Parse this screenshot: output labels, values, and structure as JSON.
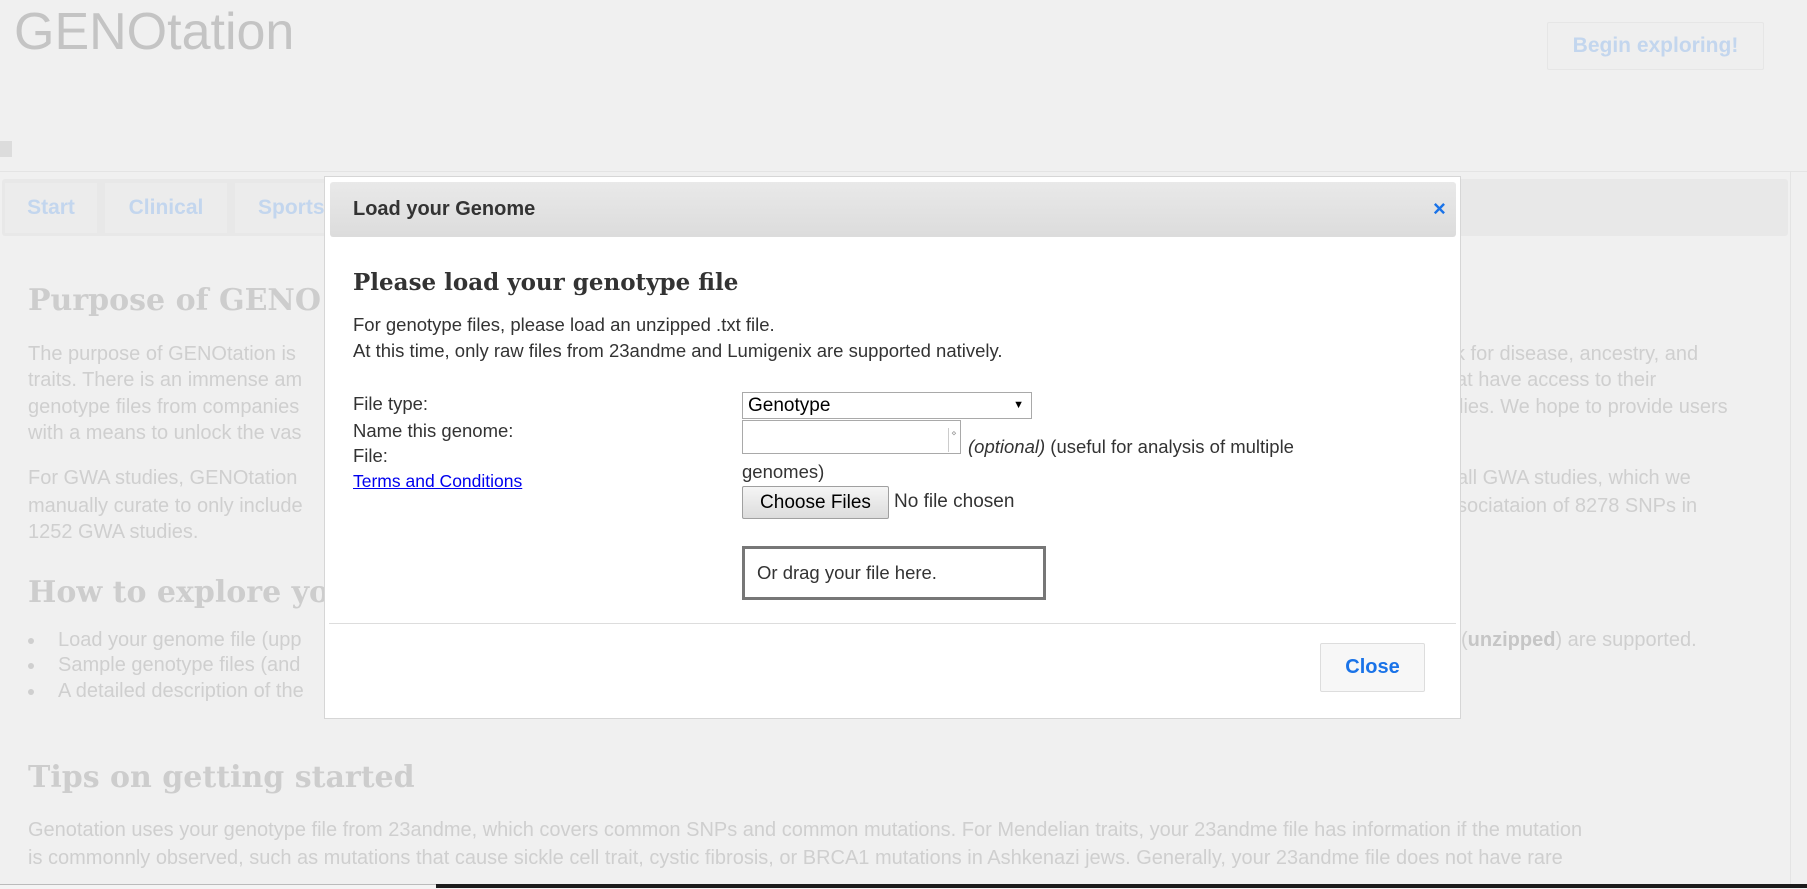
{
  "header": {
    "brand": "GENOtation",
    "begin_button": "Begin exploring!"
  },
  "tabs": [
    {
      "label": "Start"
    },
    {
      "label": "Clinical"
    },
    {
      "label": "Sports"
    }
  ],
  "background": {
    "purpose_heading": "Purpose of GENO",
    "purpose_left": [
      "The purpose of GENOtation is",
      "traits. There is an immense am",
      "genotype files from companies",
      "with a means to unlock the vas"
    ],
    "purpose_right": [
      "k for disease, ancestry, and",
      "at have access to their",
      "lies. We hope to provide users"
    ],
    "gwa_left": [
      "For GWA studies, GENOtation",
      "manually curate to only include",
      "1252 GWA studies."
    ],
    "gwa_right": [
      "all GWA studies, which we",
      "sociataion of 8278 SNPs in"
    ],
    "explore_heading": "How to explore yo",
    "bullets_left": [
      "Load your genome file (upp",
      "Sample genotype files (and",
      "A detailed description of the"
    ],
    "bullet1_right_open": "(",
    "bullet1_right_bold": "unzipped",
    "bullet1_right_rest": ") are supported.",
    "tips_heading": "Tips on getting started",
    "tips_lines": [
      "Genotation uses your genotype file from 23andme, which covers common SNPs and common mutations. For Mendelian traits, your 23andme file has information if the mutation",
      "is commonnly observed, such as mutations that cause sickle cell trait, cystic fibrosis, or BRCA1 mutations in Ashkenazi jews. Generally, your 23andme file does not have rare"
    ]
  },
  "modal": {
    "title": "Load your Genome",
    "close_icon": "×",
    "heading": "Please load your genotype file",
    "intro": [
      "For genotype files, please load an unzipped .txt file.",
      "At this time, only raw files from 23andme and Lumigenix are supported natively."
    ],
    "labels": {
      "file_type": "File type:",
      "name": "Name this genome:",
      "file": "File:",
      "terms": "Terms and Conditions"
    },
    "file_type_value": "Genotype",
    "name_value": "",
    "optional": "(optional)",
    "optional_note": " (useful for analysis of multiple",
    "optional_note2": "genomes)",
    "choose_files": "Choose Files",
    "no_file": "No file chosen",
    "drop_zone": "Or drag your file here.",
    "close_button": "Close"
  },
  "colors": {
    "accent": "#1a73e8",
    "link": "#0000ee",
    "faded_text": "#cfcfcf"
  }
}
